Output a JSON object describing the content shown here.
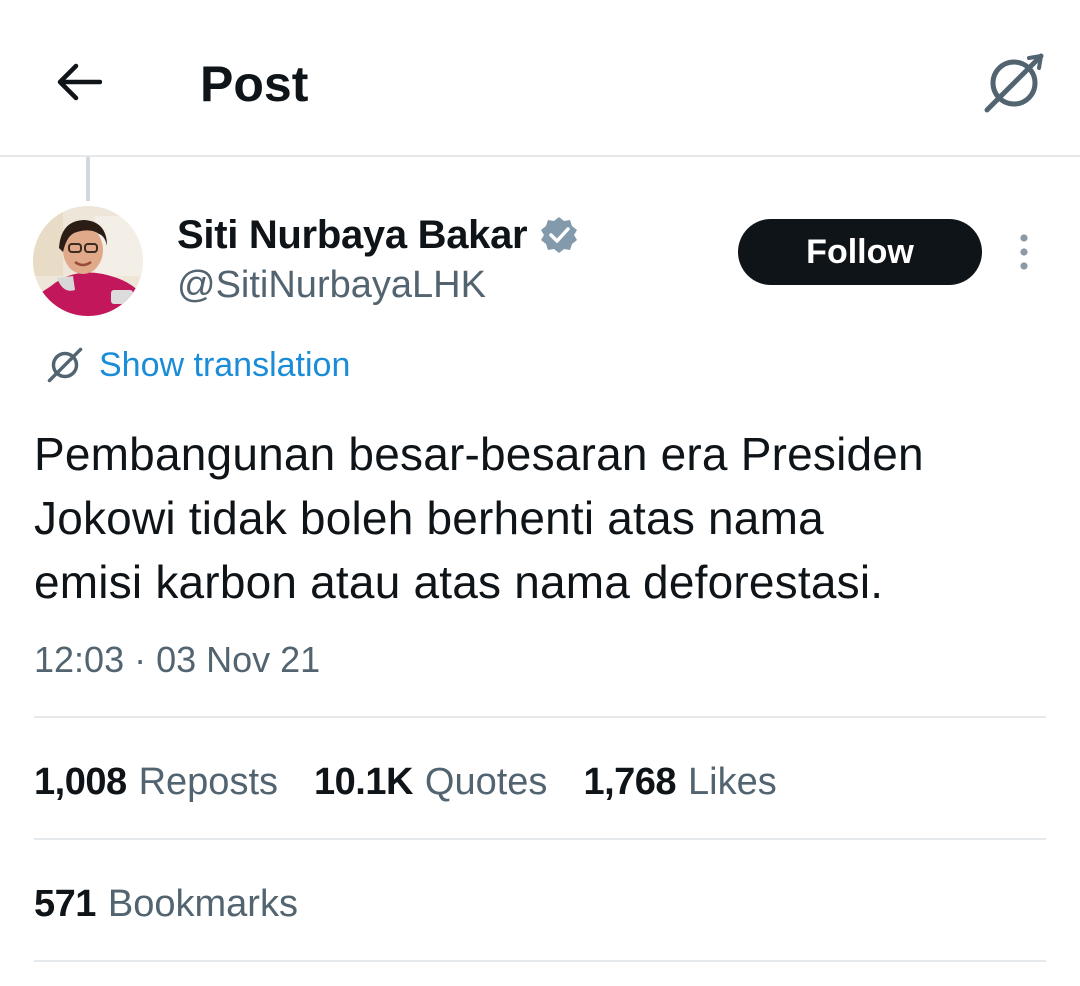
{
  "header": {
    "title": "Post",
    "back_icon": "arrow-left-icon",
    "translate_icon": "translate-icon"
  },
  "author": {
    "display_name": "Siti Nurbaya Bakar",
    "handle": "@SitiNurbayaLHK",
    "verified_icon": "verified-badge-icon",
    "verified_color": "#829aab"
  },
  "actions": {
    "follow_label": "Follow",
    "more_icon": "more-vertical-icon"
  },
  "translation": {
    "label": "Show translation",
    "icon": "translate-icon"
  },
  "post": {
    "lines": [
      "Pembangunan besar-besaran era Presiden",
      "Jokowi tidak boleh berhenti atas nama",
      "emisi karbon atau atas nama deforestasi."
    ],
    "timestamp": "12:03 · 03 Nov 21"
  },
  "stats": {
    "reposts": {
      "count": "1,008",
      "label": "Reposts"
    },
    "quotes": {
      "count": "10.1K",
      "label": "Quotes"
    },
    "likes": {
      "count": "1,768",
      "label": "Likes"
    },
    "bookmarks": {
      "count": "571",
      "label": "Bookmarks"
    }
  },
  "colors": {
    "text_primary": "#0f1419",
    "text_secondary": "#536471",
    "link": "#1a8cd8",
    "button_bg": "#0f1419",
    "divider": "#e6e9eb"
  }
}
